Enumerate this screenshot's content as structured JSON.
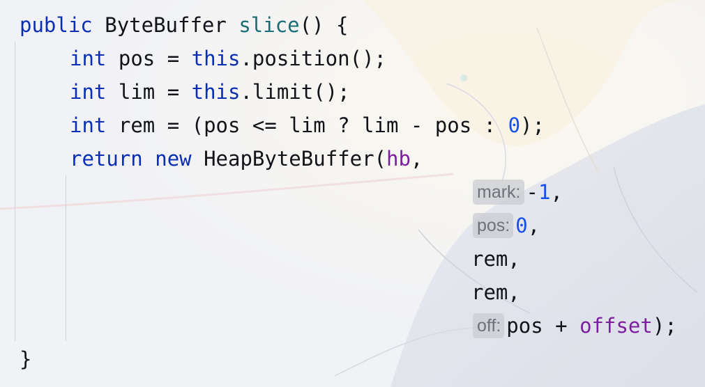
{
  "code": {
    "l1": {
      "kw": "public",
      "type": "ByteBuffer",
      "fn": "slice",
      "rest": "() {"
    },
    "l2": {
      "kw": "int",
      "decl": "pos = ",
      "this": "this",
      "rest": ".position();"
    },
    "l3": {
      "kw": "int",
      "decl": "lim = ",
      "this": "this",
      "rest": ".limit();"
    },
    "l4": {
      "kw": "int",
      "decl": "rem = (pos <= lim ? lim - pos : ",
      "num": "0",
      "rest": ");"
    },
    "l5": {
      "kw_return": "return",
      "kw_new": "new",
      "call": "HeapByteBuffer(",
      "field": "hb",
      "rest": ","
    },
    "l6": {
      "hint": "mark:",
      "pre": "-",
      "num": "1",
      "rest": ","
    },
    "l7": {
      "hint": "pos:",
      "num": "0",
      "rest": ","
    },
    "l8": {
      "text": "rem,"
    },
    "l9": {
      "text": "rem,"
    },
    "l10": {
      "hint": "off:",
      "pre": "pos + ",
      "field": "offset",
      "rest": ");"
    },
    "l11": {
      "text": "}"
    }
  },
  "colors": {
    "keyword": "#0a2fb3",
    "method": "#1a6d73",
    "field": "#7c1f9e",
    "number": "#1750eb",
    "text": "#111318",
    "hint_bg": "#c8cad0",
    "hint_text": "#6e717a"
  }
}
